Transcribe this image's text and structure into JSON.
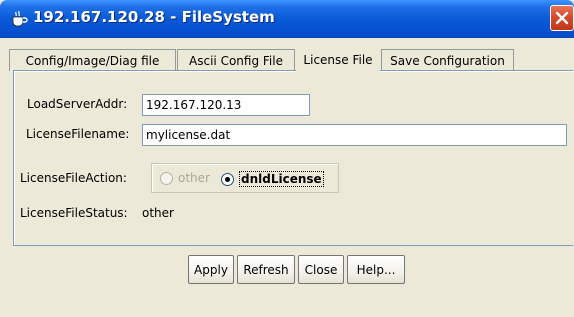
{
  "window": {
    "title": "192.167.120.28 - FileSystem",
    "title_icon": "java-cup-icon",
    "close_glyph": "close-icon"
  },
  "tabs": [
    {
      "label": "Config/Image/Diag file",
      "active": false
    },
    {
      "label": "Ascii Config File",
      "active": false
    },
    {
      "label": "License File",
      "active": true
    },
    {
      "label": "Save Configuration",
      "active": false
    }
  ],
  "form": {
    "load_server_addr_label": "LoadServerAddr:",
    "load_server_addr_value": "192.167.120.13",
    "license_filename_label": "LicenseFilename:",
    "license_filename_value": "mylicense.dat",
    "license_file_action_label": "LicenseFileAction:",
    "license_file_action_options": [
      {
        "label": "other",
        "checked": false,
        "enabled": false
      },
      {
        "label": "dnldLicense",
        "checked": true,
        "enabled": true
      }
    ],
    "license_file_status_label": "LicenseFileStatus:",
    "license_file_status_value": "other"
  },
  "buttons": {
    "apply": "Apply",
    "refresh": "Refresh",
    "close": "Close",
    "help": "Help..."
  },
  "colors": {
    "titlebar": "#0a5ad6",
    "window_bg": "#ece9d8",
    "close_button": "#c33717"
  }
}
